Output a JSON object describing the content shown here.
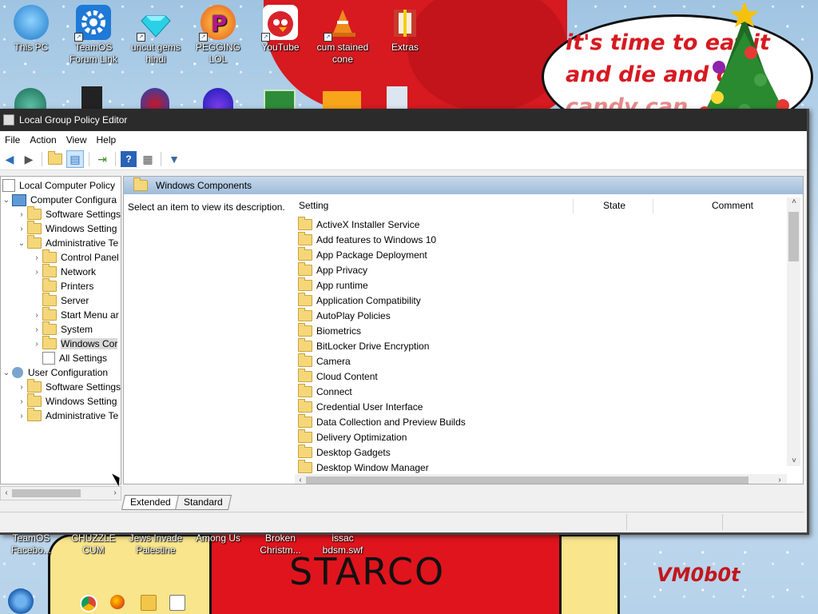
{
  "desktop": {
    "top_icons": [
      {
        "label": "This PC",
        "icon": "this-pc-icon",
        "color": "#2a8fd8"
      },
      {
        "label": "TeamOS Forum Link",
        "icon": "gear-icon",
        "color": "#1f79d6"
      },
      {
        "label": "uncut gems hindi",
        "icon": "diamond-icon",
        "color": "#21c4d8"
      },
      {
        "label": "PEGGING LOL",
        "icon": "p-logo-icon",
        "color": "#e8551b"
      },
      {
        "label": "YouTube",
        "icon": "angry-bird-icon",
        "color": "#d8232a"
      },
      {
        "label": "cum stained cone",
        "icon": "traffic-cone-icon",
        "color": "#f08a1c"
      },
      {
        "label": "Extras",
        "icon": "archive-icon",
        "color": "#c73a2c"
      }
    ],
    "bottom_icons": [
      {
        "label": "TeamOS Facebo..."
      },
      {
        "label": "CHUZZLE CUM"
      },
      {
        "label": "Jews Invade Palestine"
      },
      {
        "label": "Among Us"
      },
      {
        "label": "Broken Christm..."
      },
      {
        "label": "issac bdsm.swf"
      }
    ],
    "speech_bubble": {
      "line1": "it's time to eat it",
      "line2": "and die and c",
      "line3": "candy can"
    },
    "painting_text": "STARCO",
    "signature": "VM0b0t"
  },
  "window": {
    "title": "Local Group Policy Editor",
    "menu": [
      "File",
      "Action",
      "View",
      "Help"
    ],
    "toolbar": [
      "back-arrow-icon",
      "forward-arrow-icon",
      "up-folder-icon",
      "show-hide-tree-icon",
      "export-list-icon",
      "help-icon",
      "properties-icon",
      "filter-icon"
    ],
    "tree": {
      "root": "Local Computer Policy",
      "computer_config": "Computer Configura",
      "cc_software": "Software Settings",
      "cc_windows": "Windows Setting",
      "cc_admin": "Administrative Te",
      "control_panel": "Control Panel",
      "network": "Network",
      "printers": "Printers",
      "server": "Server",
      "start_menu": "Start Menu ar",
      "system": "System",
      "windows_components": "Windows Cor",
      "all_settings": "All Settings",
      "user_config": "User Configuration",
      "uc_software": "Software Settings",
      "uc_windows": "Windows Setting",
      "uc_admin": "Administrative Te"
    },
    "right": {
      "header": "Windows Components",
      "description": "Select an item to view its description.",
      "columns": {
        "setting": "Setting",
        "state": "State",
        "comment": "Comment"
      },
      "items": [
        "ActiveX Installer Service",
        "Add features to Windows 10",
        "App Package Deployment",
        "App Privacy",
        "App runtime",
        "Application Compatibility",
        "AutoPlay Policies",
        "Biometrics",
        "BitLocker Drive Encryption",
        "Camera",
        "Cloud Content",
        "Connect",
        "Credential User Interface",
        "Data Collection and Preview Builds",
        "Delivery Optimization",
        "Desktop Gadgets",
        "Desktop Window Manager"
      ]
    },
    "tabs": {
      "extended": "Extended",
      "standard": "Standard"
    }
  },
  "taskbar": {
    "icons": [
      "start-orb-icon",
      "chrome-icon",
      "firefox-icon",
      "file-explorer-icon",
      "notepad-icon"
    ]
  }
}
